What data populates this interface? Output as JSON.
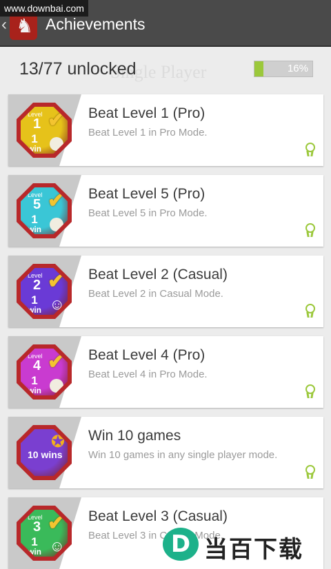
{
  "watermark_url": "www.downbai.com",
  "appbar": {
    "title": "Achievements"
  },
  "summary": {
    "unlocked_text": "13/77 unlocked",
    "progress_text": "16%",
    "progress_fraction": 0.16,
    "background_text": "Single Player"
  },
  "achievements": [
    {
      "title": "Beat Level 1 (Pro)",
      "desc": "Beat Level 1 in Pro Mode.",
      "medal_level": "1",
      "medal_color": "#e6c21a"
    },
    {
      "title": "Beat Level 5 (Pro)",
      "desc": "Beat Level 5 in Pro Mode.",
      "medal_level": "5",
      "medal_color": "#3ac6d6"
    },
    {
      "title": "Beat Level 2 (Casual)",
      "desc": "Beat Level 2 in Casual Mode.",
      "medal_level": "2",
      "medal_color": "#6a3ad6"
    },
    {
      "title": "Beat Level 4 (Pro)",
      "desc": "Beat Level 4 in Pro Mode.",
      "medal_level": "4",
      "medal_color": "#c93bd0"
    },
    {
      "title": "Win 10 games",
      "desc": "Win 10 games in any single player mode.",
      "medal_wins": "10 wins",
      "medal_color": "#7a3fd0"
    },
    {
      "title": "Beat Level 3 (Casual)",
      "desc": "Beat Level 3 in Casual Mode.",
      "medal_level": "3",
      "medal_color": "#3aba5a"
    }
  ],
  "medal_text": {
    "level_word": "Level",
    "win_one": "1",
    "win_word": "win"
  },
  "download_badge": {
    "logo_letter": "D",
    "text": "当百下载"
  },
  "colors": {
    "accent_green": "#9bc83b",
    "appbar": "#4a4a4a"
  }
}
